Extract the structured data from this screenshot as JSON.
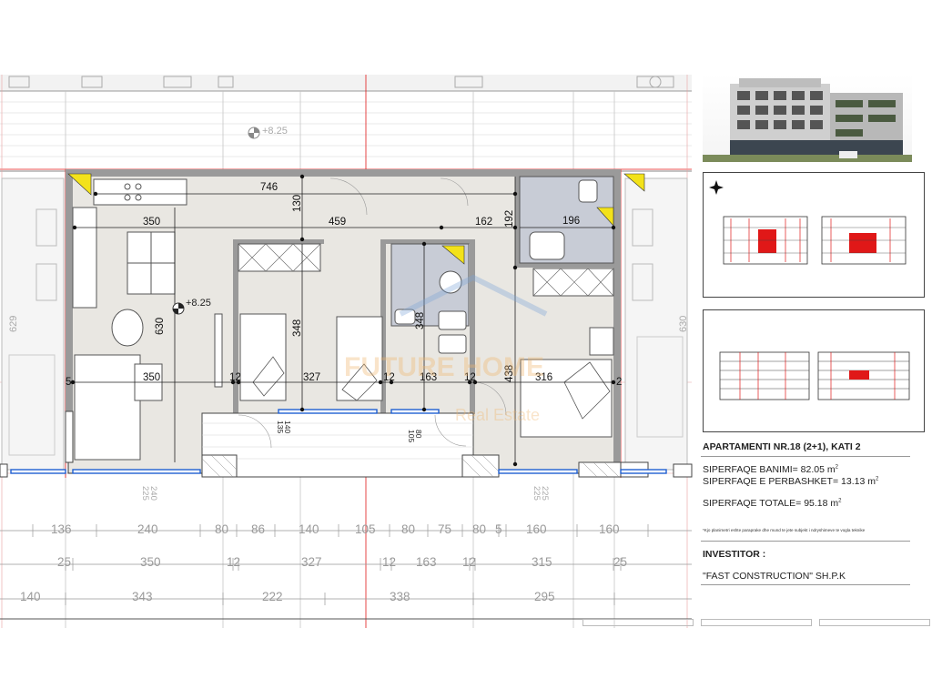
{
  "plan": {
    "elevation_labels": [
      "+8.25",
      "+8.25"
    ],
    "room_dims": [
      {
        "id": "d746",
        "text": "746"
      },
      {
        "id": "d130",
        "text": "130"
      },
      {
        "id": "d350a",
        "text": "350"
      },
      {
        "id": "d459",
        "text": "459"
      },
      {
        "id": "d162",
        "text": "162"
      },
      {
        "id": "d192",
        "text": "192"
      },
      {
        "id": "d196",
        "text": "196"
      },
      {
        "id": "d630a",
        "text": "630"
      },
      {
        "id": "d348a",
        "text": "348"
      },
      {
        "id": "d348b",
        "text": "348"
      },
      {
        "id": "d438",
        "text": "438"
      },
      {
        "id": "d5",
        "text": "5"
      },
      {
        "id": "d350b",
        "text": "350"
      },
      {
        "id": "d12a",
        "text": "12"
      },
      {
        "id": "d327",
        "text": "327"
      },
      {
        "id": "d12b",
        "text": "12"
      },
      {
        "id": "d163",
        "text": "163"
      },
      {
        "id": "d12c",
        "text": "12"
      },
      {
        "id": "d316",
        "text": "316"
      },
      {
        "id": "d2",
        "text": "2"
      },
      {
        "id": "d629",
        "text": "629"
      },
      {
        "id": "d630b",
        "text": "630"
      },
      {
        "id": "w140",
        "text": "140"
      },
      {
        "id": "w135",
        "text": "135"
      },
      {
        "id": "w80",
        "text": "80"
      },
      {
        "id": "w105",
        "text": "105"
      },
      {
        "id": "w240",
        "text": "240"
      },
      {
        "id": "w225a",
        "text": "225"
      },
      {
        "id": "w225b",
        "text": "225"
      },
      {
        "id": "w225c",
        "text": "225"
      }
    ],
    "dim_row1": [
      "136",
      "240",
      "80",
      "86",
      "140",
      "105",
      "80",
      "75",
      "80",
      "5",
      "160",
      "160"
    ],
    "dim_row2": [
      "25",
      "350",
      "12",
      "327",
      "12",
      "163",
      "12",
      "315",
      "25"
    ],
    "dim_row3": [
      "140",
      "343",
      "222",
      "338",
      "295"
    ]
  },
  "watermark": {
    "line1": "FUTURE HOME",
    "line2": "Real Estate"
  },
  "info": {
    "title": "APARTAMENTI NR.18 (2+1), KATI 2",
    "area_living_label": "SIPERFAQE BANIMI=",
    "area_living_value": "82.05 m",
    "area_shared_label": "SIPERFAQE E PERBASHKET=",
    "area_shared_value": "13.13 m",
    "area_total_label": "SIPERFAQE TOTALE=",
    "area_total_value": "95.18 m",
    "unit_sup": "2",
    "disclaimer": "*Kjo planimetri eshte paraprake dhe mund te jete subjekt i ndryshimeve te vogla teknike",
    "investor_heading": "INVESTITOR :",
    "investor_name": "\"FAST CONSTRUCTION\" SH.P.K"
  },
  "colors": {
    "accent": "#e01818",
    "yellow": "#f3e21a",
    "blue": "#1f5fd1",
    "wall": "#555555",
    "grid": "#c9c9c9"
  }
}
